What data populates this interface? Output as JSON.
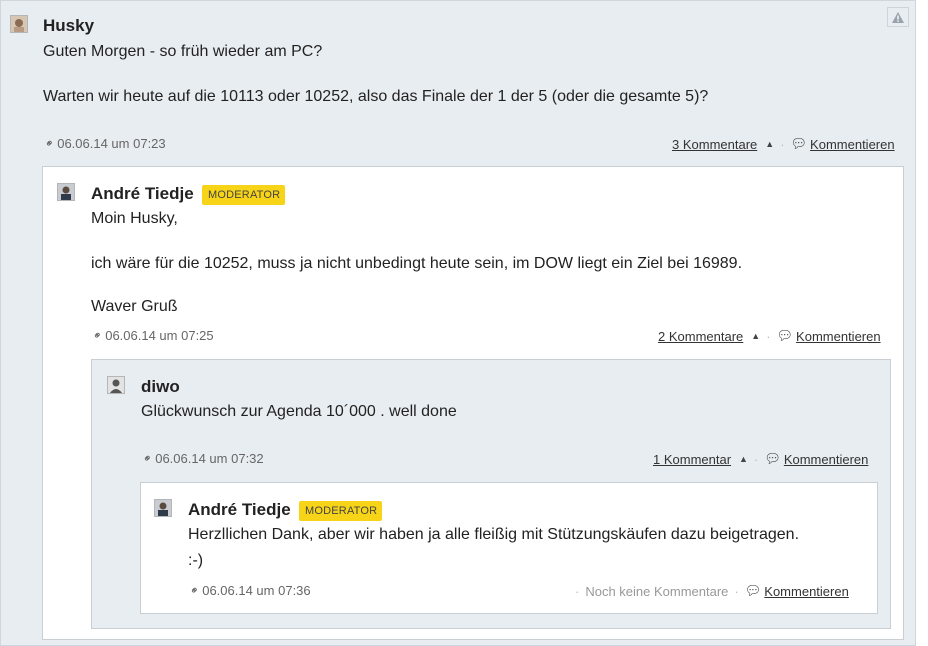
{
  "comments": [
    {
      "author": "Husky",
      "badge": "",
      "lines": [
        "Guten Morgen - so früh wieder am PC?",
        "Warten wir heute auf die 10113 oder 10252, also das Finale der 1 der 5 (oder die gesamte 5)?"
      ],
      "date": "06.06.14 um 07:23",
      "replies_label": "3 Kommentare",
      "comment_label": "Kommentieren"
    },
    {
      "author": "André Tiedje",
      "badge": "MODERATOR",
      "lines": [
        "Moin Husky,",
        "ich wäre für die 10252, muss ja nicht unbedingt heute sein, im DOW liegt ein Ziel bei 16989.",
        "Waver Gruß"
      ],
      "date": "06.06.14 um 07:25",
      "replies_label": "2 Kommentare",
      "comment_label": "Kommentieren"
    },
    {
      "author": "diwo",
      "badge": "",
      "lines": [
        "Glückwunsch zur Agenda 10´000 . well done"
      ],
      "date": "06.06.14 um 07:32",
      "replies_label": "1 Kommentar",
      "comment_label": "Kommentieren"
    },
    {
      "author": "André Tiedje",
      "badge": "MODERATOR",
      "lines": [
        "Herzllichen Dank, aber wir haben ja alle fleißig mit Stützungskäufen dazu beigetragen.",
        ":-)"
      ],
      "date": "06.06.14 um 07:36",
      "replies_label": "Noch keine Kommentare",
      "comment_label": "Kommentieren"
    }
  ],
  "icons": {
    "report": "warning-icon",
    "permalink": "link-icon",
    "toggle": "caret-up-icon",
    "comment": "speech-bubble-icon"
  },
  "colors": {
    "background": "#e8edf2",
    "nested_background": "#ffffff",
    "badge": "#f7d417"
  }
}
